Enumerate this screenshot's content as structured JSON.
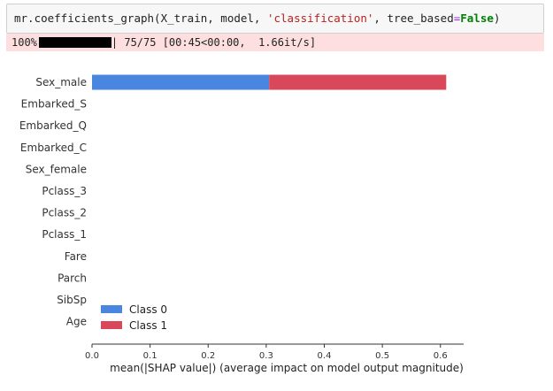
{
  "code": {
    "prefix": "mr.coefficients_graph(X_train, model, ",
    "string_arg": "'classification'",
    "mid": ", tree_based",
    "eq": "=",
    "keyword": "False",
    "suffix": ")"
  },
  "progress": {
    "percent_text": "100%",
    "fraction": 1.0,
    "status_text": "| 75/75 [00:45<00:00,  1.66it/s]"
  },
  "chart_data": {
    "type": "bar",
    "orientation": "horizontal",
    "stacked": true,
    "categories": [
      "Sex_male",
      "Embarked_S",
      "Embarked_Q",
      "Embarked_C",
      "Sex_female",
      "Pclass_3",
      "Pclass_2",
      "Pclass_1",
      "Fare",
      "Parch",
      "SibSp",
      "Age"
    ],
    "series": [
      {
        "name": "Class 0",
        "color": "#4a86e0",
        "values": [
          0.305,
          0,
          0,
          0,
          0,
          0,
          0,
          0,
          0,
          0,
          0,
          0
        ]
      },
      {
        "name": "Class 1",
        "color": "#d9475a",
        "values": [
          0.305,
          0,
          0,
          0,
          0,
          0,
          0,
          0,
          0,
          0,
          0,
          0
        ]
      }
    ],
    "xlim": [
      0,
      0.64
    ],
    "xticks": [
      "0.0",
      "0.1",
      "0.2",
      "0.3",
      "0.4",
      "0.5",
      "0.6"
    ],
    "xlabel": "mean(|SHAP value|) (average impact on model output magnitude)",
    "ylabel": "",
    "title": "",
    "legend_position": "bottom-left",
    "grid": false
  }
}
